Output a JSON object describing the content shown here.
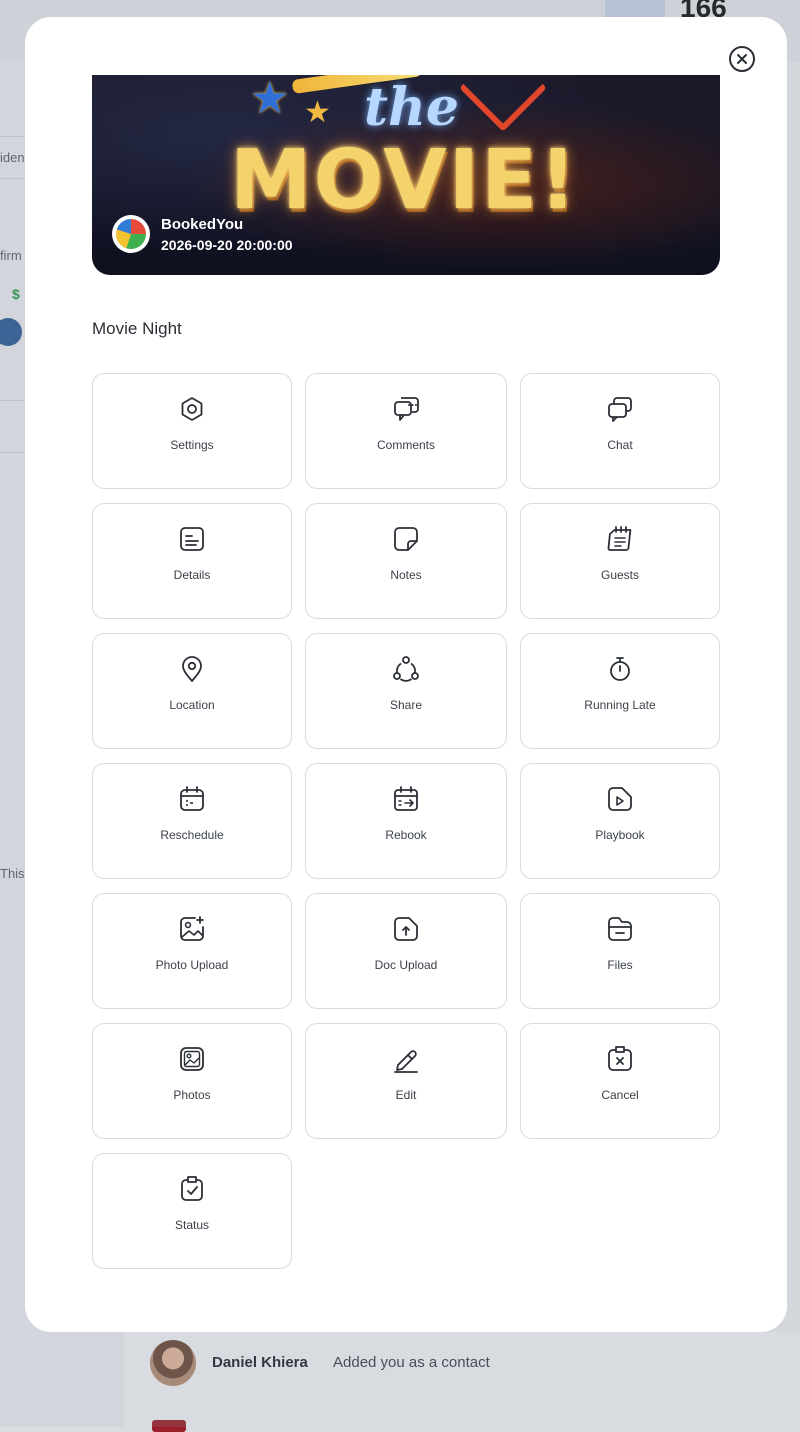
{
  "background": {
    "notification": {
      "name": "Daniel Khiera",
      "message": "Added you as a contact"
    },
    "stat_number": "166",
    "left_fragments": [
      "iden",
      "firm",
      "$",
      "This"
    ]
  },
  "modal": {
    "close_icon": "close-circle-icon",
    "banner": {
      "line1": "the",
      "line2": "MOVIE!",
      "host_name": "BookedYou",
      "datetime": "2026-09-20 20:00:00"
    },
    "event_title": "Movie Night",
    "tiles": [
      {
        "label": "Settings",
        "icon": "settings-icon"
      },
      {
        "label": "Comments",
        "icon": "comments-icon"
      },
      {
        "label": "Chat",
        "icon": "chat-icon"
      },
      {
        "label": "Details",
        "icon": "details-icon"
      },
      {
        "label": "Notes",
        "icon": "notes-icon"
      },
      {
        "label": "Guests",
        "icon": "guests-icon"
      },
      {
        "label": "Location",
        "icon": "location-icon"
      },
      {
        "label": "Share",
        "icon": "share-icon"
      },
      {
        "label": "Running Late",
        "icon": "stopwatch-icon"
      },
      {
        "label": "Reschedule",
        "icon": "reschedule-calendar-icon"
      },
      {
        "label": "Rebook",
        "icon": "rebook-calendar-icon"
      },
      {
        "label": "Playbook",
        "icon": "playbook-icon"
      },
      {
        "label": "Photo Upload",
        "icon": "photo-upload-icon"
      },
      {
        "label": "Doc Upload",
        "icon": "doc-upload-icon"
      },
      {
        "label": "Files",
        "icon": "folder-icon"
      },
      {
        "label": "Photos",
        "icon": "photos-icon"
      },
      {
        "label": "Edit",
        "icon": "pencil-icon"
      },
      {
        "label": "Cancel",
        "icon": "cancel-icon"
      },
      {
        "label": "Status",
        "icon": "status-clipboard-icon"
      }
    ]
  }
}
